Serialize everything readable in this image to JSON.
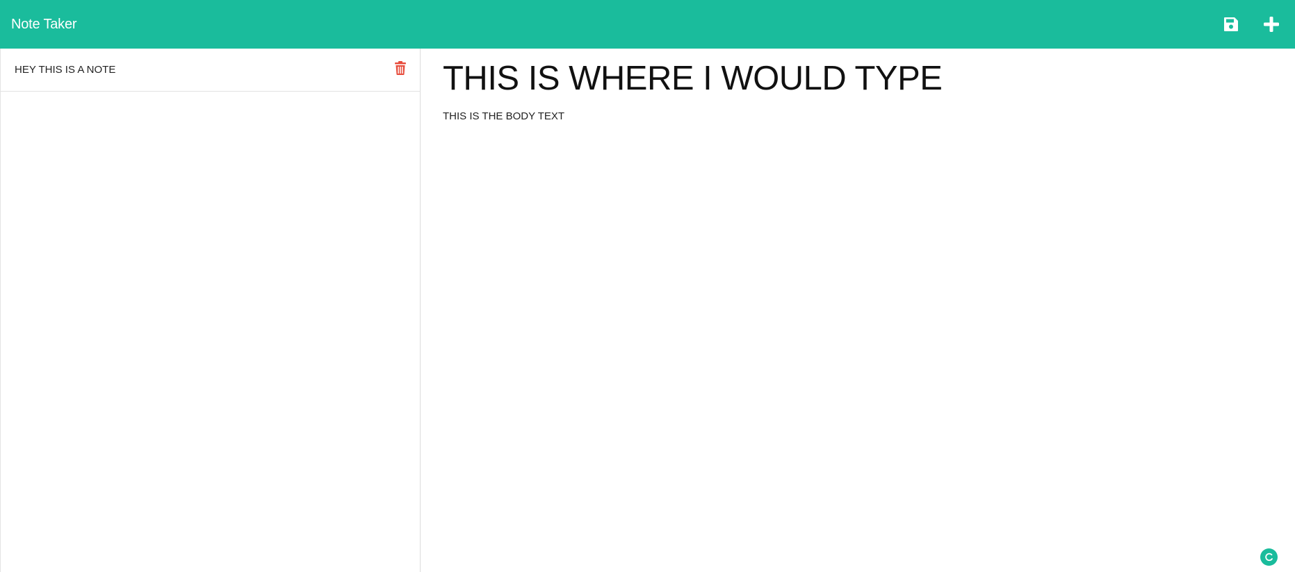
{
  "app": {
    "title": "Note Taker"
  },
  "nav": {
    "actions": [
      {
        "name": "save-icon"
      },
      {
        "name": "plus-icon"
      }
    ]
  },
  "sidebar": {
    "notes": [
      {
        "title": "HEY THIS IS A NOTE"
      }
    ]
  },
  "editor": {
    "title": "THIS IS WHERE I WOULD TYPE",
    "body": "THIS IS THE BODY TEXT"
  },
  "colors": {
    "accent": "#1abc9c",
    "delete": "#e74c3c"
  }
}
